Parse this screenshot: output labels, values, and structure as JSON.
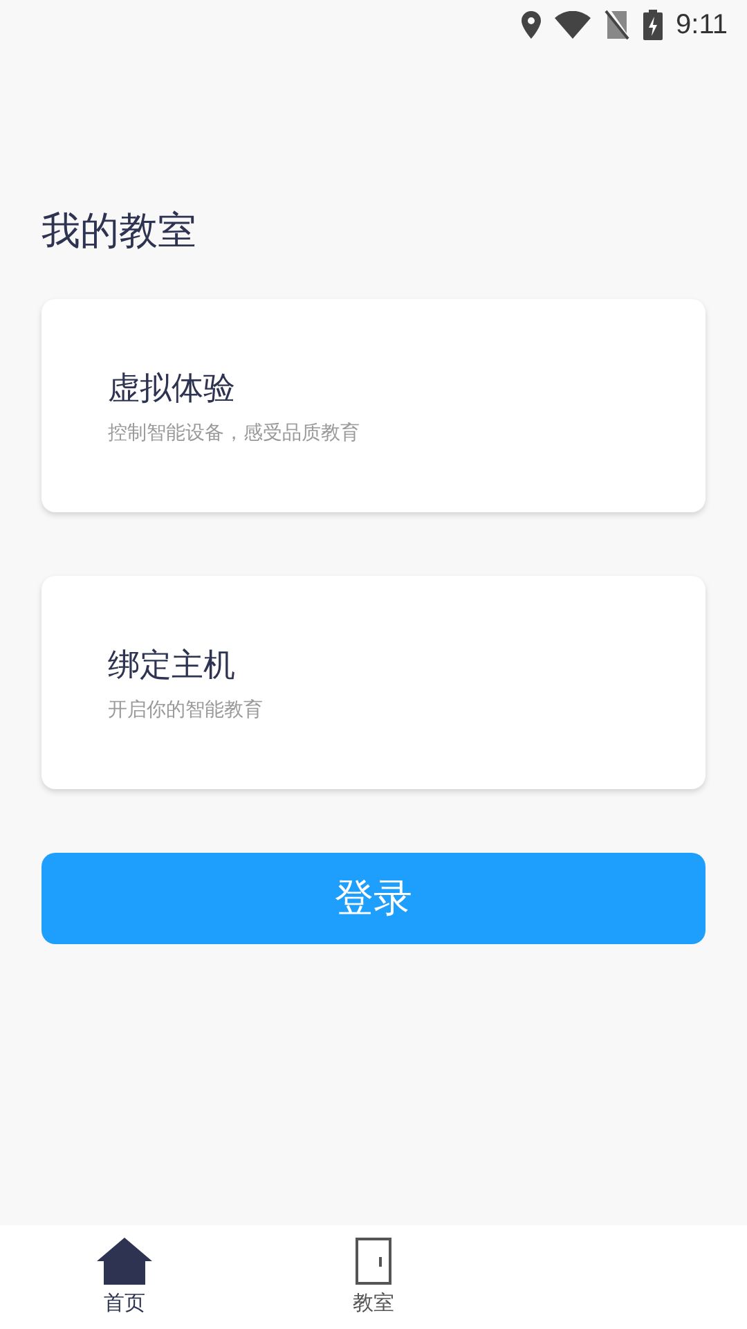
{
  "status_bar": {
    "time": "9:11"
  },
  "page_title": "我的教室",
  "cards": [
    {
      "title": "虚拟体验",
      "subtitle": "控制智能设备，感受品质教育"
    },
    {
      "title": "绑定主机",
      "subtitle": "开启你的智能教育"
    }
  ],
  "login_button": "登录",
  "tabs": [
    {
      "label": "首页",
      "kind": "home",
      "selected": true
    },
    {
      "label": "教室",
      "kind": "door",
      "selected": false
    }
  ]
}
